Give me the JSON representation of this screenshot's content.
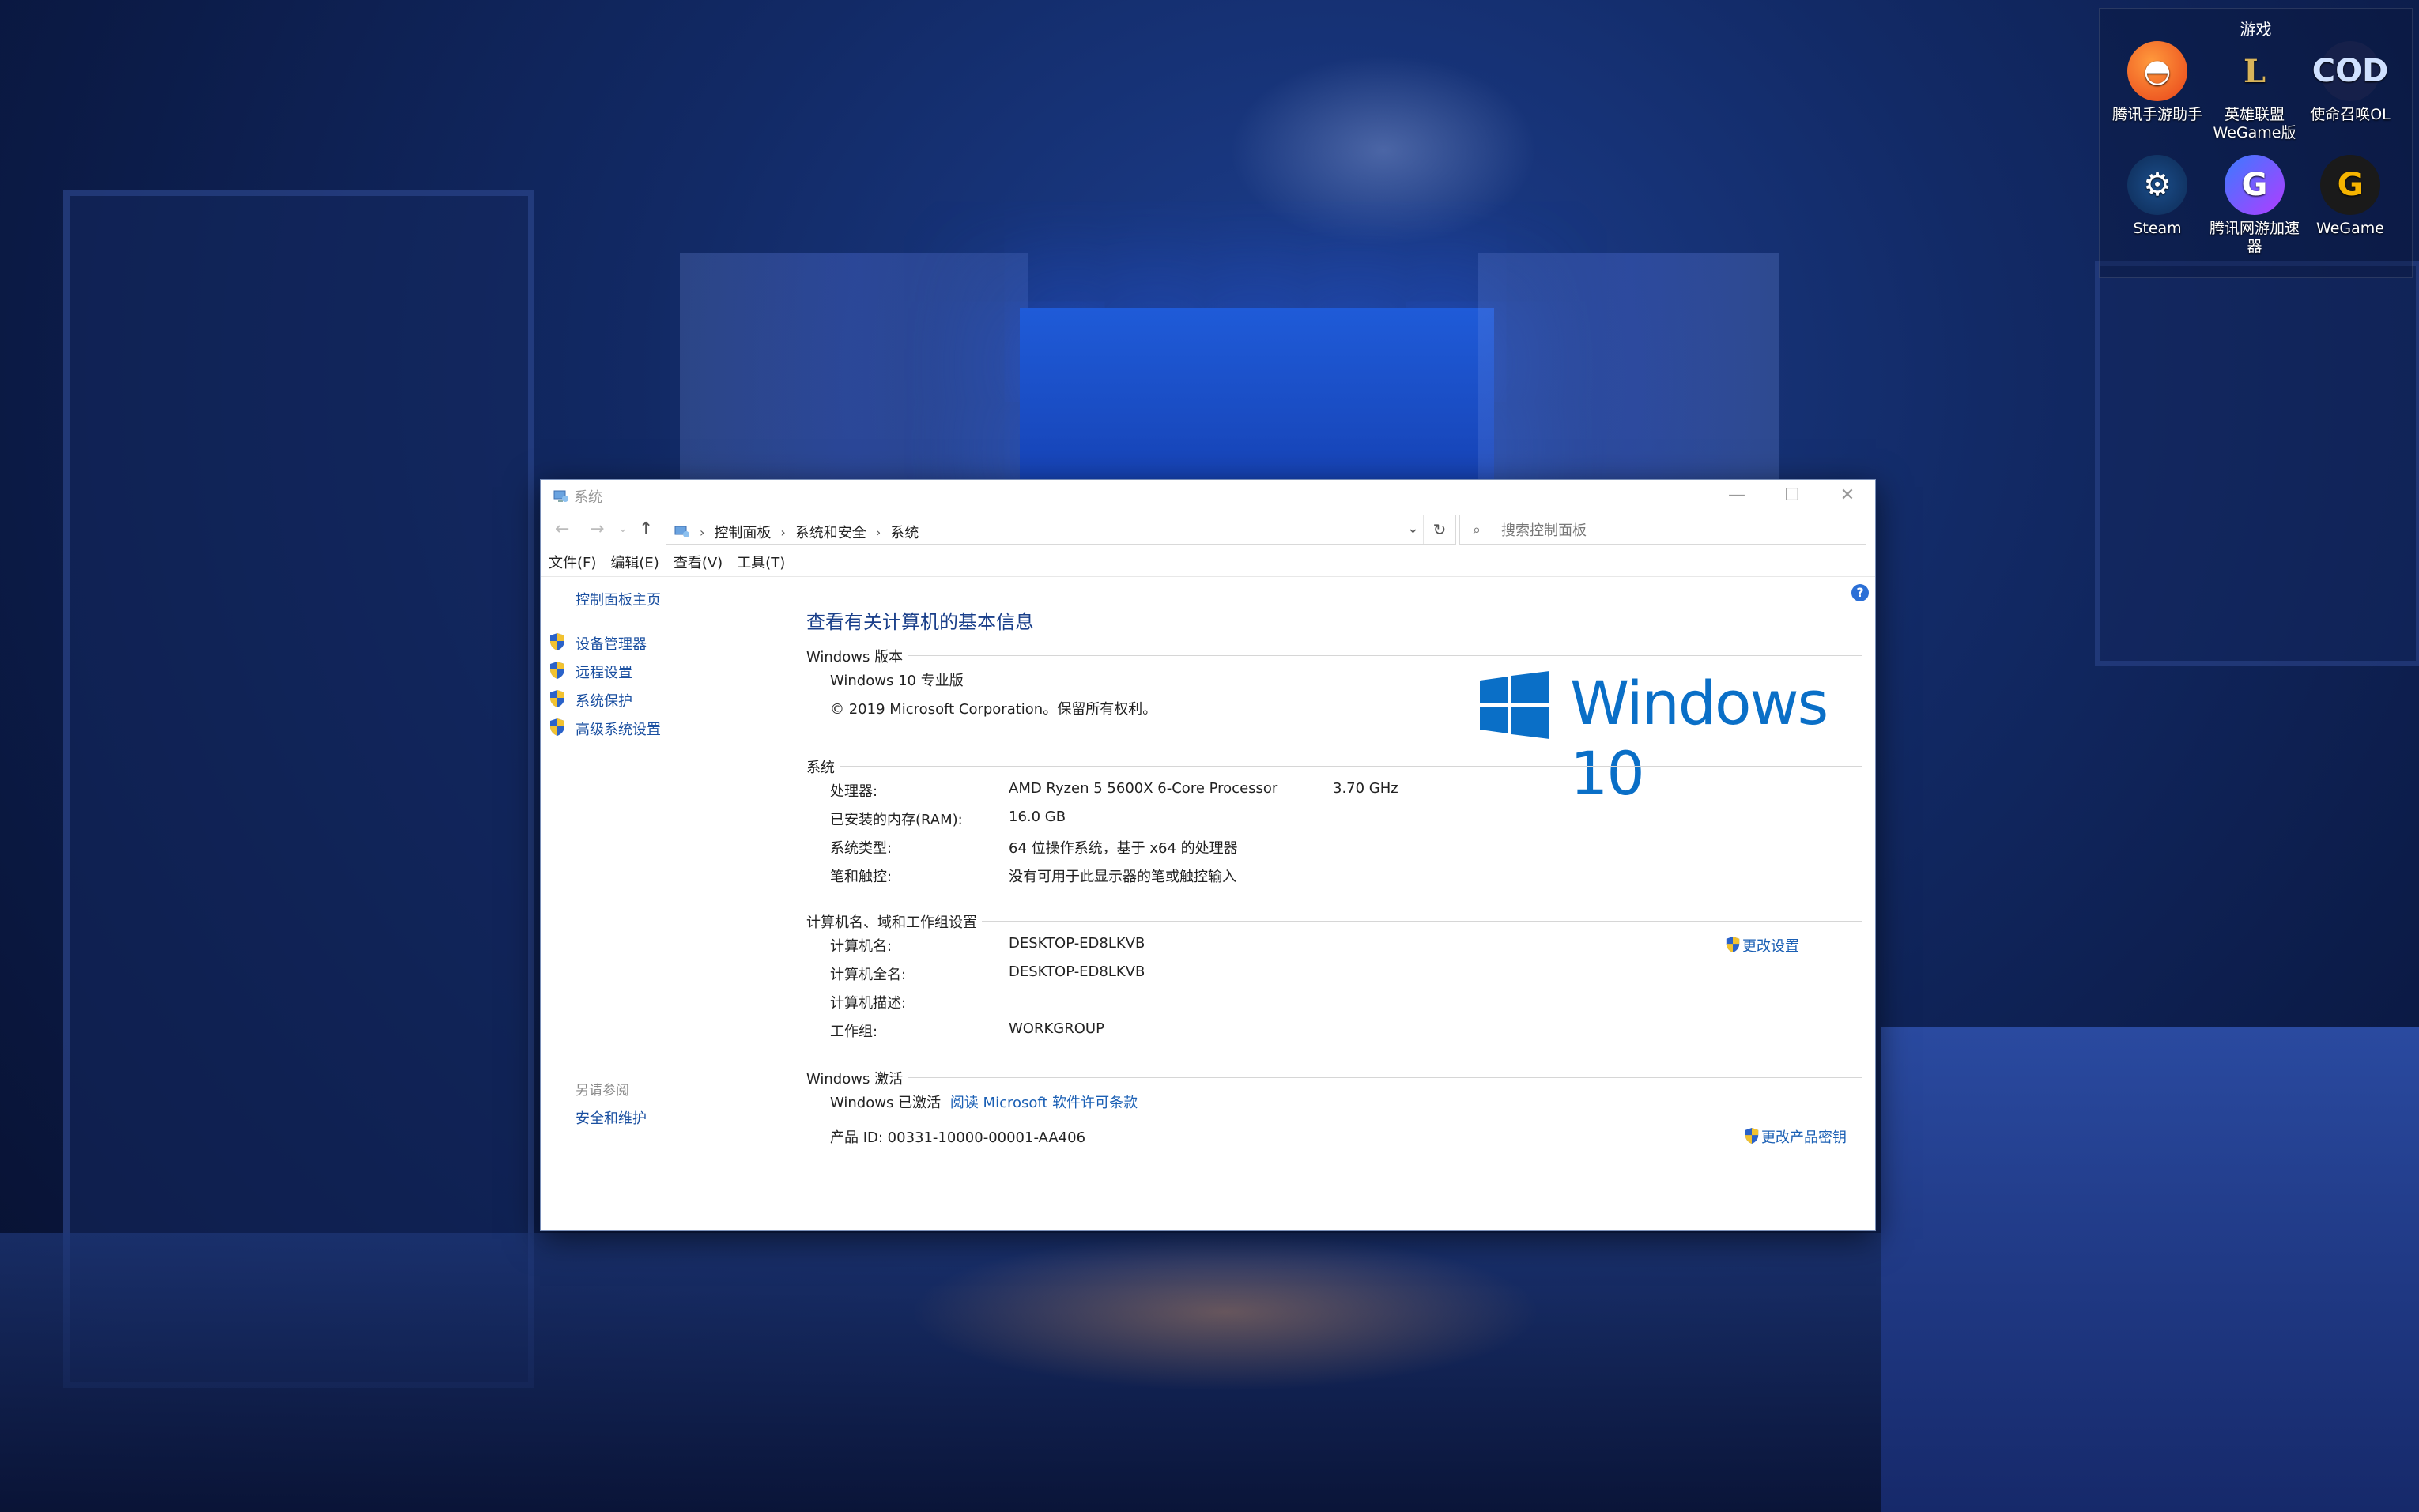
{
  "desktop": {
    "fence_title": "游戏",
    "icons": [
      {
        "label": "腾讯手游助手",
        "icon": "tencent-mobile-assistant-icon"
      },
      {
        "label": "英雄联盟WeGame版",
        "icon": "league-of-legends-icon"
      },
      {
        "label": "使命召唤OL",
        "icon": "call-of-duty-icon"
      },
      {
        "label": "Steam",
        "icon": "steam-icon"
      },
      {
        "label": "腾讯网游加速器",
        "icon": "tencent-accelerator-icon"
      },
      {
        "label": "WeGame",
        "icon": "wegame-icon"
      }
    ]
  },
  "window": {
    "title": "系统",
    "controls": {
      "minimize": "—",
      "maximize": "☐",
      "close": "✕"
    },
    "breadcrumb": [
      "控制面板",
      "系统和安全",
      "系统"
    ],
    "search_placeholder": "搜索控制面板",
    "menu": [
      "文件(F)",
      "编辑(E)",
      "查看(V)",
      "工具(T)"
    ]
  },
  "sidebar": {
    "home": "控制面板主页",
    "tasks": [
      "设备管理器",
      "远程设置",
      "系统保护",
      "高级系统设置"
    ],
    "see_also": "另请参阅",
    "see_also_link": "安全和维护"
  },
  "main": {
    "help": "?",
    "title": "查看有关计算机的基本信息",
    "edition_section": "Windows 版本",
    "edition": "Windows 10 专业版",
    "copyright": "© 2019 Microsoft Corporation。保留所有权利。",
    "logo_text": "Windows 10",
    "system_section": "系统",
    "processor_label": "处理器:",
    "processor_value": "AMD Ryzen 5 5600X 6-Core Processor",
    "processor_speed": "3.70 GHz",
    "ram_label": "已安装的内存(RAM):",
    "ram_value": "16.0 GB",
    "type_label": "系统类型:",
    "type_value": "64 位操作系统，基于 x64 的处理器",
    "pen_label": "笔和触控:",
    "pen_value": "没有可用于此显示器的笔或触控输入",
    "name_section": "计算机名、域和工作组设置",
    "cname_label": "计算机名:",
    "cname_value": "DESKTOP-ED8LKVB",
    "cfull_label": "计算机全名:",
    "cfull_value": "DESKTOP-ED8LKVB",
    "cdesc_label": "计算机描述:",
    "workgroup_label": "工作组:",
    "workgroup_value": "WORKGROUP",
    "change_settings": "更改设置",
    "activation_section": "Windows 激活",
    "activated": "Windows 已激活",
    "license_link": "阅读 Microsoft 软件许可条款",
    "product_id": "产品 ID: 00331-10000-00001-AA406",
    "change_key": "更改产品密钥"
  },
  "colors": {
    "accent": "#1a5fb4",
    "logo": "#0a6fc7"
  }
}
